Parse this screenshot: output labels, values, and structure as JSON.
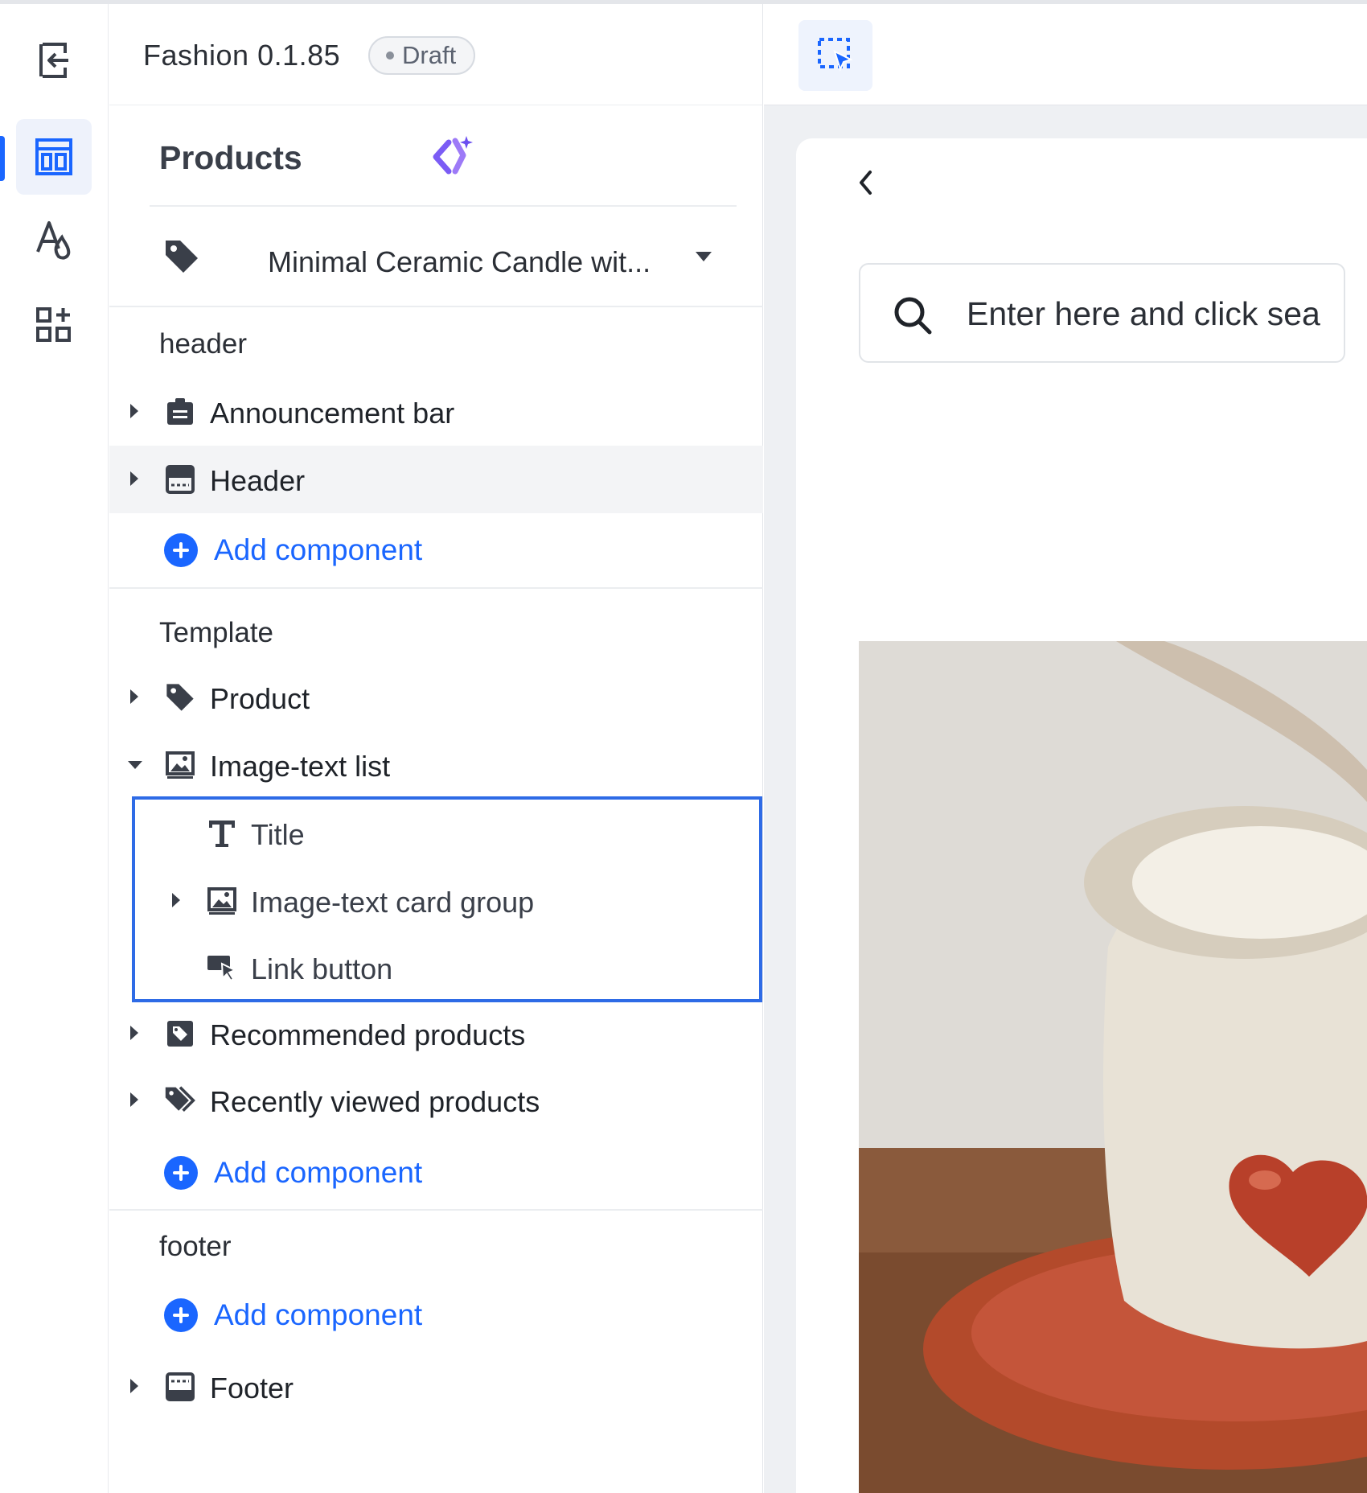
{
  "app": {
    "title": "Fashion 0.1.85",
    "status": "Draft"
  },
  "panel": {
    "section_title": "Products",
    "product_selector": "Minimal Ceramic Candle wit..."
  },
  "groups": {
    "header": {
      "label": "header",
      "items": [
        {
          "label": "Announcement bar",
          "icon": "announcement-icon"
        },
        {
          "label": "Header",
          "icon": "header-layout-icon"
        }
      ],
      "add": "Add component"
    },
    "template": {
      "label": "Template",
      "items": [
        {
          "label": "Product",
          "icon": "tag-icon"
        },
        {
          "label": "Image-text list",
          "icon": "image-icon"
        },
        {
          "label": "Title",
          "icon": "text-icon"
        },
        {
          "label": "Image-text card group",
          "icon": "image-icon"
        },
        {
          "label": "Link button",
          "icon": "link-button-icon"
        },
        {
          "label": "Recommended products",
          "icon": "recommended-icon"
        },
        {
          "label": "Recently viewed products",
          "icon": "tags-icon"
        }
      ],
      "add": "Add component"
    },
    "footer": {
      "label": "footer",
      "add": "Add component",
      "items": [
        {
          "label": "Footer",
          "icon": "footer-layout-icon"
        }
      ]
    }
  },
  "preview": {
    "search_placeholder": "Enter here and click sea"
  },
  "colors": {
    "accent": "#1a66ff",
    "selection": "#2e6be6",
    "sparkle": "#7b5cf5"
  }
}
